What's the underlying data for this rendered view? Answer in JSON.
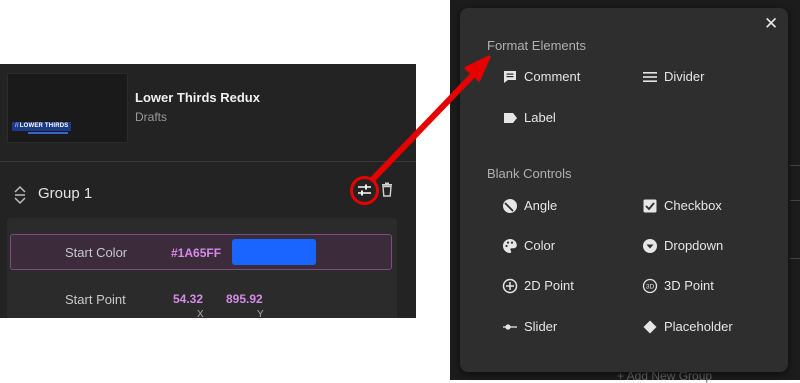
{
  "project": {
    "title": "Lower Thirds Redux",
    "subtitle": "Drafts",
    "thumbnail_text": "LOWER THIRDS"
  },
  "group": {
    "label": "Group 1"
  },
  "properties": [
    {
      "label": "Start Color",
      "value": "#1A65FF",
      "swatch_color": "#1A65FF"
    },
    {
      "label": "Start Point",
      "x_value": "54.32",
      "y_value": "895.92",
      "x_axis": "X",
      "y_axis": "Y"
    }
  ],
  "popup": {
    "close_glyph": "✕",
    "format_title": "Format Elements",
    "format_items": [
      {
        "label": "Comment",
        "icon": "comment-icon"
      },
      {
        "label": "Divider",
        "icon": "divider-icon"
      },
      {
        "label": "Label",
        "icon": "label-icon"
      }
    ],
    "controls_title": "Blank Controls",
    "control_items": [
      {
        "label": "Angle",
        "icon": "angle-icon"
      },
      {
        "label": "Checkbox",
        "icon": "checkbox-icon"
      },
      {
        "label": "Color",
        "icon": "palette-icon"
      },
      {
        "label": "Dropdown",
        "icon": "dropdown-icon"
      },
      {
        "label": "2D Point",
        "icon": "2d-point-icon"
      },
      {
        "label": "3D Point",
        "icon": "3d-point-icon"
      },
      {
        "label": "Slider",
        "icon": "slider-icon"
      },
      {
        "label": "Placeholder",
        "icon": "placeholder-icon"
      }
    ]
  },
  "background": {
    "add_group_label": "+ Add New Group"
  },
  "colors": {
    "highlight_arrow": "#e60000",
    "prop_value": "#d58be8",
    "start_color": "#1A65FF"
  }
}
